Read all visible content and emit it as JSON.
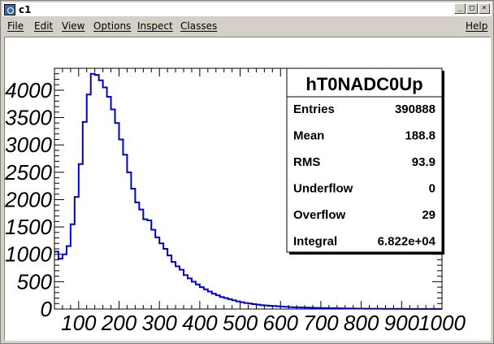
{
  "window": {
    "title": "c1",
    "buttons": [
      "_",
      "□",
      "×"
    ]
  },
  "menubar": {
    "items": [
      "File",
      "Edit",
      "View",
      "Options",
      "Inspect",
      "Classes"
    ],
    "help": "Help"
  },
  "stats": {
    "title": "hT0NADC0Up",
    "rows": [
      {
        "label": "Entries",
        "value": "390888"
      },
      {
        "label": "Mean",
        "value": "188.8"
      },
      {
        "label": "RMS",
        "value": "93.9"
      },
      {
        "label": "Underflow",
        "value": "0"
      },
      {
        "label": "Overflow",
        "value": "29"
      },
      {
        "label": "Integral",
        "value": "6.822e+04"
      }
    ]
  },
  "colors": {
    "histogram": "#0000cc"
  },
  "chart_data": {
    "type": "histogram",
    "title": "",
    "xlabel": "",
    "ylabel": "",
    "xlim": [
      40,
      1000
    ],
    "ylim": [
      0,
      4400
    ],
    "x_ticks": [
      100,
      200,
      300,
      400,
      500,
      600,
      700,
      800,
      900,
      1000
    ],
    "y_ticks": [
      0,
      500,
      1000,
      1500,
      2000,
      2500,
      3000,
      3500,
      4000
    ],
    "bin_width": 10,
    "bin_start": 40,
    "values": [
      1050,
      920,
      1000,
      1150,
      1550,
      2050,
      2650,
      3420,
      3920,
      4300,
      4280,
      4180,
      4050,
      3880,
      3650,
      3400,
      3100,
      2820,
      2500,
      2200,
      1950,
      1820,
      1640,
      1620,
      1450,
      1310,
      1200,
      1100,
      980,
      860,
      780,
      720,
      620,
      560,
      500,
      450,
      400,
      360,
      320,
      280,
      250,
      220,
      200,
      180,
      160,
      140,
      125,
      110,
      100,
      90,
      80,
      70,
      65,
      60,
      55,
      50,
      45,
      40,
      35,
      32,
      30,
      28,
      26,
      24,
      22,
      20,
      18,
      16,
      15,
      14,
      13,
      12,
      11,
      10,
      9,
      8,
      7,
      6,
      6,
      5,
      5,
      4,
      4,
      4,
      3,
      3,
      3,
      2,
      2,
      2,
      2,
      1,
      1,
      1,
      1,
      1
    ]
  }
}
